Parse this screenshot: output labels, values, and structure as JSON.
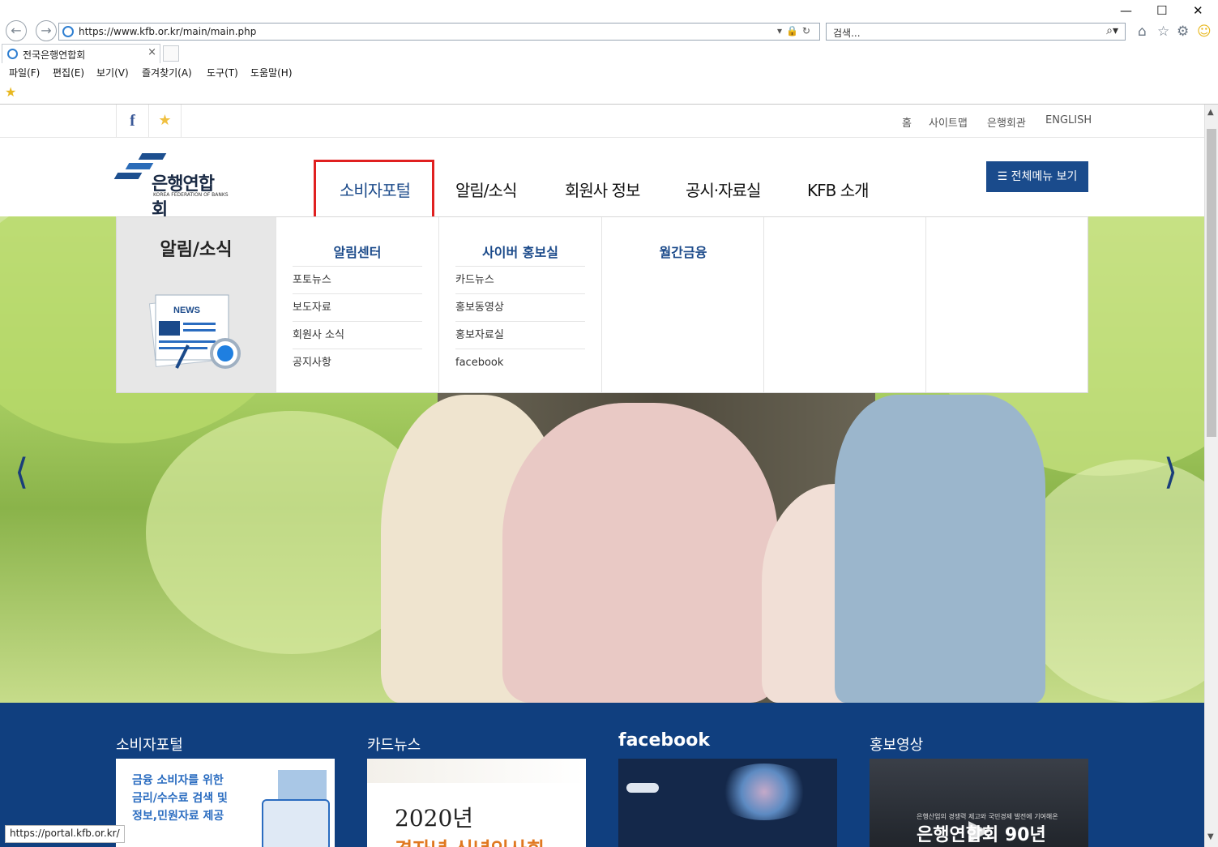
{
  "browser": {
    "url": "https://www.kfb.or.kr/main/main.php",
    "search_placeholder": "검색...",
    "tab_title": "전국은행연합회",
    "menu": [
      "파일(F)",
      "편집(E)",
      "보기(V)",
      "즐겨찾기(A)",
      "도구(T)",
      "도움말(H)"
    ],
    "status_url": "https://portal.kfb.or.kr/"
  },
  "util_links": [
    "홈",
    "사이트맵",
    "은행회관",
    "ENGLISH"
  ],
  "logo": {
    "name": "은행연합회",
    "eng": "KOREA FEDERATION OF BANKS"
  },
  "gnb": [
    "소비자포털",
    "알림/소식",
    "회원사 정보",
    "공시·자료실",
    "KFB 소개"
  ],
  "all_menu_label": "전체메뉴 보기",
  "dropdown": {
    "side_title": "알림/소식",
    "news_label": "NEWS",
    "columns": [
      {
        "heading": "알림센터",
        "items": [
          "포토뉴스",
          "보도자료",
          "회원사 소식",
          "공지사항"
        ]
      },
      {
        "heading": "사이버 홍보실",
        "items": [
          "카드뉴스",
          "홍보동영상",
          "홍보자료실",
          "facebook"
        ]
      },
      {
        "heading": "월간금융",
        "items": []
      }
    ]
  },
  "band": {
    "sections": [
      "소비자포털",
      "카드뉴스",
      "facebook",
      "홍보영상"
    ],
    "consumer_text": [
      "금융 소비자를 위한",
      "금리/수수료 검색 및",
      "정보,민원자료 제공"
    ],
    "card_text_year": "2020년",
    "card_text_sub": "경자년 신년인사회",
    "video_text": "은행연합회 90년",
    "video_subtext": "은행산업의 경쟁력 제고와 국민경제 발전에 기여해온"
  },
  "colors": {
    "brand_blue": "#1a4b8c",
    "band_blue": "#103f7f",
    "highlight_red": "#e02020"
  }
}
